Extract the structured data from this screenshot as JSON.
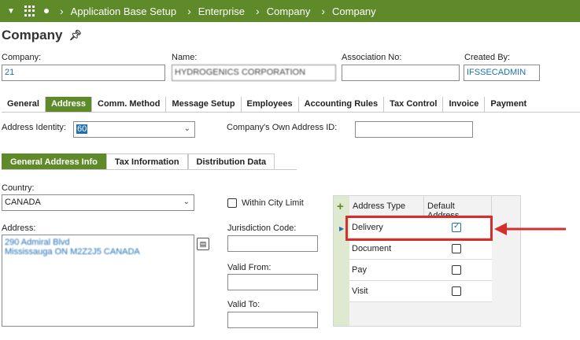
{
  "topbar": {
    "breadcrumb": [
      "Application Base Setup",
      "Enterprise",
      "Company",
      "Company"
    ]
  },
  "page": {
    "title": "Company"
  },
  "header_fields": {
    "company_label": "Company:",
    "company_value": "21",
    "name_label": "Name:",
    "name_value": "HYDROGENICS CORPORATION",
    "association_label": "Association No:",
    "association_value": "",
    "created_by_label": "Created By:",
    "created_by_value": "IFSSECADMIN"
  },
  "tabs": [
    "General",
    "Address",
    "Comm. Method",
    "Message Setup",
    "Employees",
    "Accounting Rules",
    "Tax Control",
    "Invoice",
    "Payment"
  ],
  "address": {
    "identity_label": "Address Identity:",
    "identity_value": "60",
    "own_id_label": "Company's Own Address ID:",
    "own_id_value": ""
  },
  "subtabs": [
    "General Address Info",
    "Tax Information",
    "Distribution Data"
  ],
  "general_info": {
    "country_label": "Country:",
    "country_value": "CANADA",
    "address_label": "Address:",
    "address_line1": "290 Admiral Blvd",
    "address_line2": "Mississauga ON M2Z2J5 CANADA",
    "within_city_label": "Within City Limit",
    "jurisdiction_label": "Jurisdiction Code:",
    "valid_from_label": "Valid From:",
    "valid_to_label": "Valid To:"
  },
  "address_types": {
    "col_type": "Address Type",
    "col_default": "Default Address",
    "rows": [
      {
        "type": "Delivery",
        "default": true
      },
      {
        "type": "Document",
        "default": false
      },
      {
        "type": "Pay",
        "default": false
      },
      {
        "type": "Visit",
        "default": false
      }
    ]
  },
  "colors": {
    "brand": "#5e8a2a",
    "link": "#1f6fb2",
    "annotation": "#d32f2f"
  }
}
